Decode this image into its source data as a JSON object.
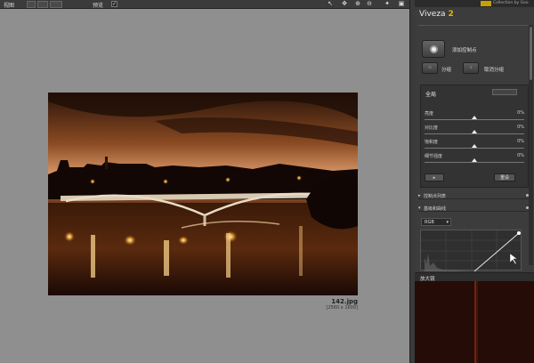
{
  "toolbar": {
    "view_label": "视图",
    "preview_label": "预览",
    "preview_checked": "✓"
  },
  "image": {
    "filename": "142.jpg",
    "dimensions": "[2560 x 1600]"
  },
  "panel": {
    "brand_collection": "Collection by Goo",
    "app_name": "Viveza",
    "app_version": "2",
    "add_control_point": "添加控制点",
    "group": "分组",
    "ungroup": "取消分组",
    "global": {
      "title": "全局",
      "sliders": [
        {
          "name": "亮度",
          "value": "0%",
          "level": 0.5
        },
        {
          "name": "对比度",
          "value": "0%",
          "level": 0.5
        },
        {
          "name": "饱和度",
          "value": "0%",
          "level": 0.5
        },
        {
          "name": "细节强度",
          "value": "0%",
          "level": 0.5
        }
      ],
      "reset_label": "重设"
    },
    "sections": {
      "control_point_list": "控制点列表",
      "levels_curves": "基级和曲线"
    },
    "channel": "RGB",
    "loupe": "放大镜"
  },
  "colors": {
    "accent": "#e7b400",
    "panel_bg": "#3c3c3c",
    "canvas_bg": "#8f8f8f"
  }
}
